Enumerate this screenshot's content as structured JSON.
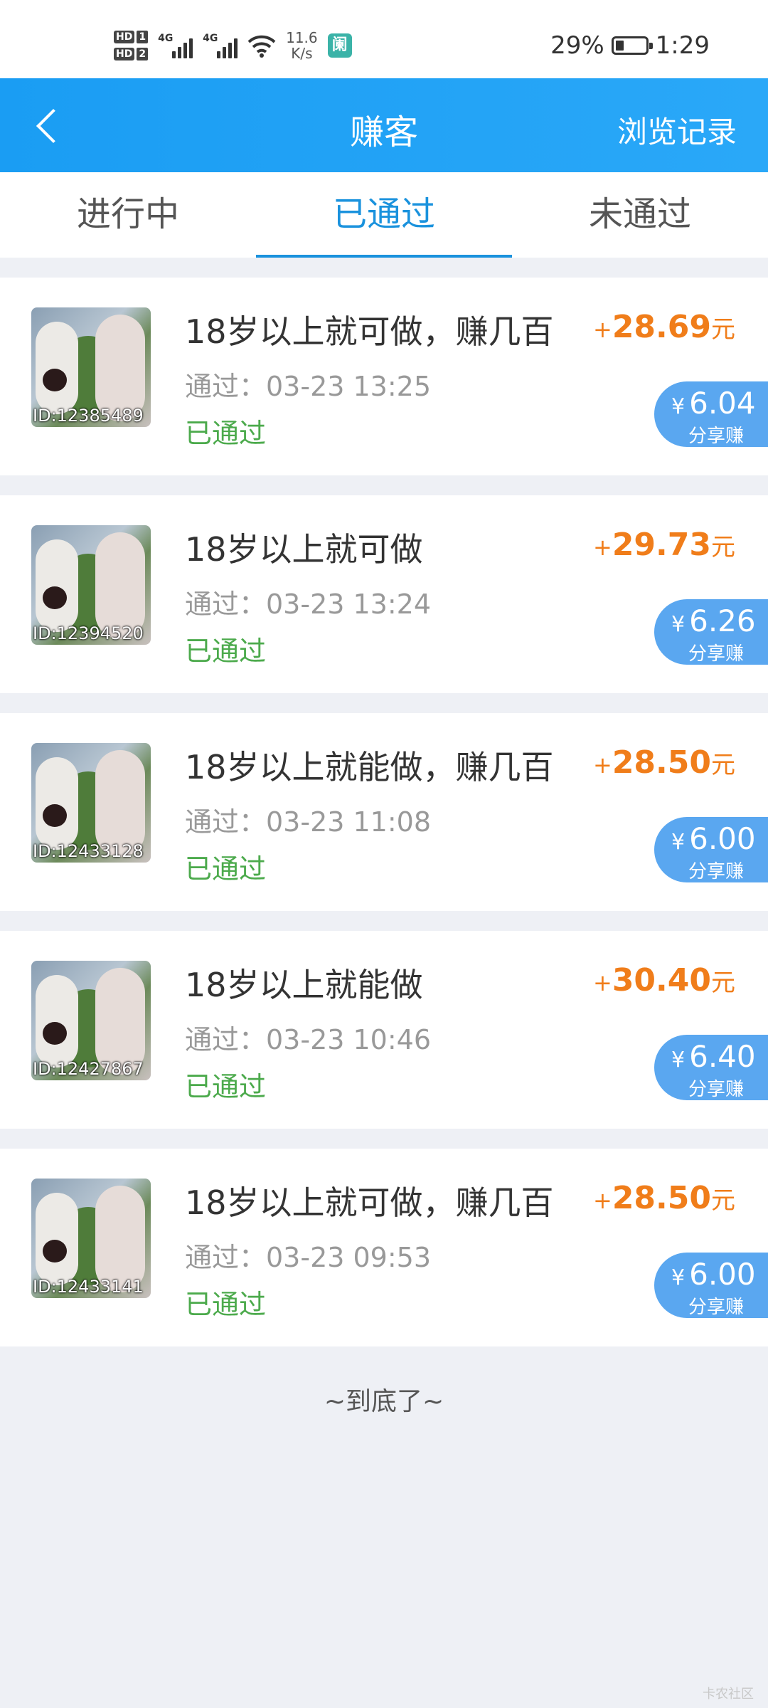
{
  "status_bar": {
    "hd1": "HD",
    "hd1_num": "1",
    "hd2": "HD",
    "hd2_num": "2",
    "net1": "4G",
    "net2": "4G",
    "speed_value": "11.6",
    "speed_unit": "K/s",
    "app_icon_glyph": "阑",
    "battery_percent": "29%",
    "time": "1:29"
  },
  "header": {
    "title": "赚客",
    "right_link": "浏览记录",
    "back_icon": "chevron-left-icon"
  },
  "tabs": [
    {
      "label": "进行中",
      "active": false
    },
    {
      "label": "已通过",
      "active": true
    },
    {
      "label": "未通过",
      "active": false
    }
  ],
  "items": [
    {
      "id_label": "ID:12385489",
      "title": "18岁以上就可做，赚几百",
      "time": "通过：03-23 13:25",
      "status": "已通过",
      "amount_plus": "+",
      "amount": "28.69",
      "amount_unit": "元",
      "share_currency": "¥",
      "share_value": "6.04",
      "share_label": "分享赚"
    },
    {
      "id_label": "ID:12394520",
      "title": "18岁以上就可做",
      "time": "通过：03-23 13:24",
      "status": "已通过",
      "amount_plus": "+",
      "amount": "29.73",
      "amount_unit": "元",
      "share_currency": "¥",
      "share_value": "6.26",
      "share_label": "分享赚"
    },
    {
      "id_label": "ID:12433128",
      "title": "18岁以上就能做，赚几百",
      "time": "通过：03-23 11:08",
      "status": "已通过",
      "amount_plus": "+",
      "amount": "28.50",
      "amount_unit": "元",
      "share_currency": "¥",
      "share_value": "6.00",
      "share_label": "分享赚"
    },
    {
      "id_label": "ID:12427867",
      "title": "18岁以上就能做",
      "time": "通过：03-23 10:46",
      "status": "已通过",
      "amount_plus": "+",
      "amount": "30.40",
      "amount_unit": "元",
      "share_currency": "¥",
      "share_value": "6.40",
      "share_label": "分享赚"
    },
    {
      "id_label": "ID:12433141",
      "title": "18岁以上就可做，赚几百",
      "time": "通过：03-23 09:53",
      "status": "已通过",
      "amount_plus": "+",
      "amount": "28.50",
      "amount_unit": "元",
      "share_currency": "¥",
      "share_value": "6.00",
      "share_label": "分享赚"
    }
  ],
  "footer_text": "~到底了~",
  "watermark": "卡农社区",
  "colors": {
    "header_bg": "#1a9df3",
    "tab_active": "#1a92dd",
    "amount": "#f07d1a",
    "status_green": "#4caa4c",
    "share_bg": "#5aa7f0"
  }
}
